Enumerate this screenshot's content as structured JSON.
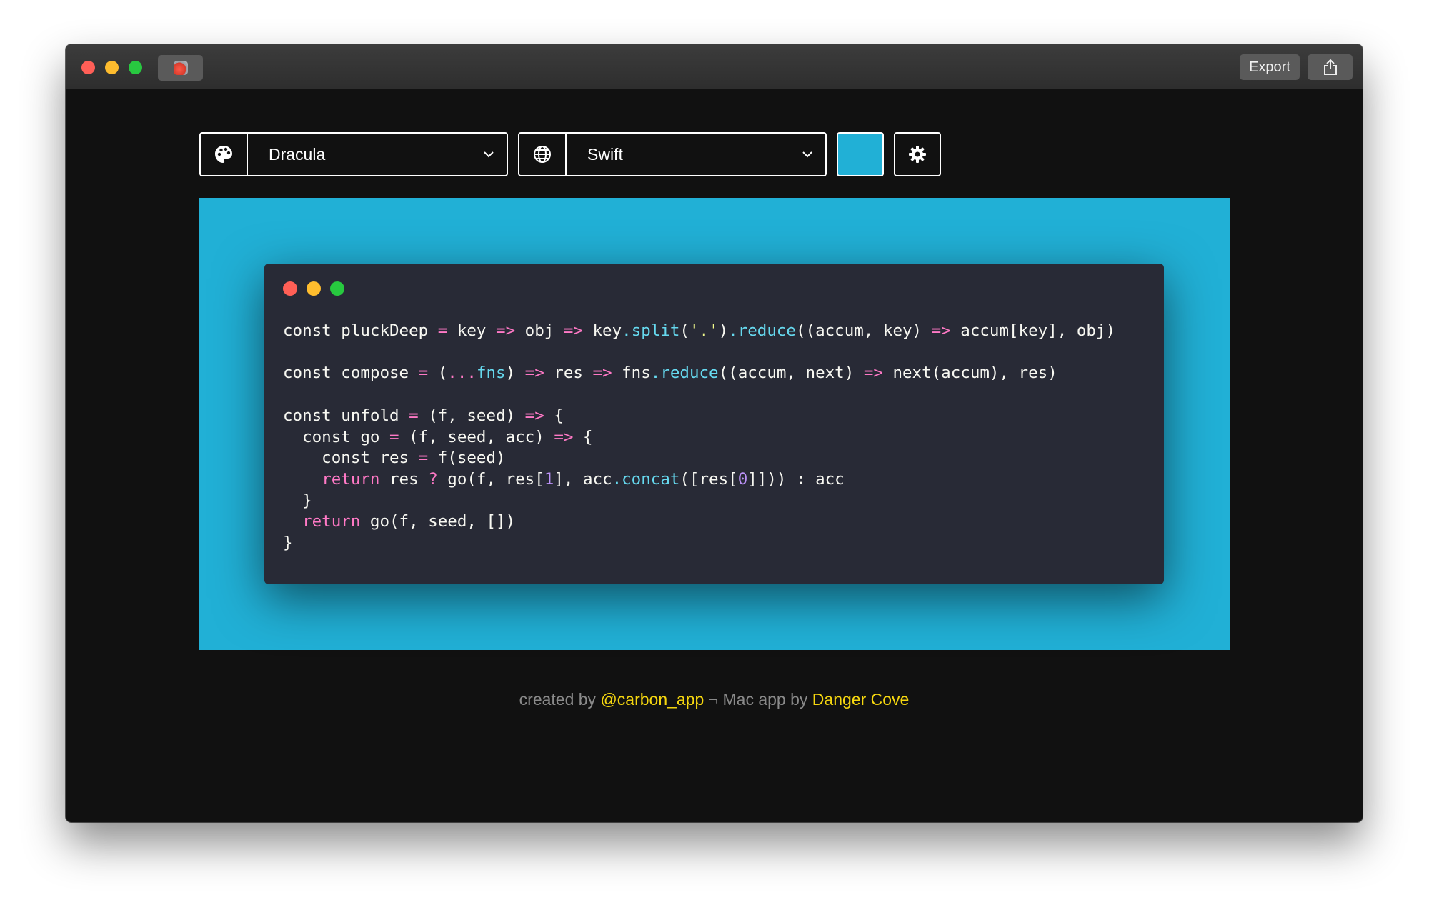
{
  "titlebar": {
    "export_label": "Export",
    "app_icon": "carbon-jar-icon",
    "share_icon": "share-icon"
  },
  "toolbar": {
    "theme": {
      "icon": "palette-icon",
      "value": "Dracula"
    },
    "language": {
      "icon": "globe-icon",
      "value": "Swift"
    },
    "background_color": "#21b0d6",
    "settings_icon": "gear-icon"
  },
  "code_window": {
    "background": "#282a36",
    "lines": [
      [
        [
          "const pluckDeep ",
          ""
        ],
        [
          "=",
          "op"
        ],
        [
          " key ",
          ""
        ],
        [
          "=>",
          "op"
        ],
        [
          " obj ",
          ""
        ],
        [
          "=>",
          "op"
        ],
        [
          " key",
          ""
        ],
        [
          ".",
          "fn"
        ],
        [
          "split",
          "fn"
        ],
        [
          "(",
          ""
        ],
        [
          "'.'",
          "str"
        ],
        [
          ")",
          ""
        ],
        [
          ".",
          "fn"
        ],
        [
          "reduce",
          "fn"
        ],
        [
          "((accum, key) ",
          ""
        ],
        [
          "=>",
          "op"
        ],
        [
          " accum[key], obj)",
          ""
        ]
      ],
      [],
      [
        [
          "const compose ",
          ""
        ],
        [
          "=",
          "op"
        ],
        [
          " (",
          ""
        ],
        [
          "...",
          "op"
        ],
        [
          "fns",
          "fn"
        ],
        [
          ") ",
          ""
        ],
        [
          "=>",
          "op"
        ],
        [
          " res ",
          ""
        ],
        [
          "=>",
          "op"
        ],
        [
          " fns",
          ""
        ],
        [
          ".",
          "fn"
        ],
        [
          "reduce",
          "fn"
        ],
        [
          "((accum, next) ",
          ""
        ],
        [
          "=>",
          "op"
        ],
        [
          " next(accum), res)",
          ""
        ]
      ],
      [],
      [
        [
          "const unfold ",
          ""
        ],
        [
          "=",
          "op"
        ],
        [
          " (f, seed) ",
          ""
        ],
        [
          "=>",
          "op"
        ],
        [
          " {",
          ""
        ]
      ],
      [
        [
          "  const go ",
          ""
        ],
        [
          "=",
          "op"
        ],
        [
          " (f, seed, acc) ",
          ""
        ],
        [
          "=>",
          "op"
        ],
        [
          " {",
          ""
        ]
      ],
      [
        [
          "    const res ",
          ""
        ],
        [
          "=",
          "op"
        ],
        [
          " f(seed)",
          ""
        ]
      ],
      [
        [
          "    ",
          ""
        ],
        [
          "return",
          "kw"
        ],
        [
          " res ",
          ""
        ],
        [
          "?",
          "op"
        ],
        [
          " go(f, res[",
          ""
        ],
        [
          "1",
          "num"
        ],
        [
          "], acc",
          ""
        ],
        [
          ".",
          "fn"
        ],
        [
          "concat",
          "fn"
        ],
        [
          "([res[",
          ""
        ],
        [
          "0",
          "num"
        ],
        [
          "]])) : acc",
          ""
        ]
      ],
      [
        [
          "  }",
          ""
        ]
      ],
      [
        [
          "  ",
          ""
        ],
        [
          "return",
          "kw"
        ],
        [
          " go(f, seed, [])",
          ""
        ]
      ],
      [
        [
          "}",
          ""
        ]
      ]
    ]
  },
  "footer": {
    "created_by": "created by ",
    "carbon_link": "@carbon_app",
    "separator": " ¬ Mac app by ",
    "danger_cove_link": "Danger Cove"
  }
}
